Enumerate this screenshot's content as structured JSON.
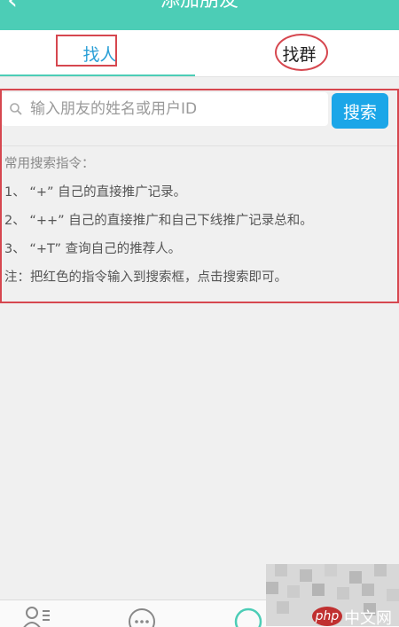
{
  "header": {
    "title": "添加朋友",
    "back_glyph": "‹"
  },
  "tabs": [
    {
      "label": "找人",
      "active": true
    },
    {
      "label": "找群",
      "active": false
    }
  ],
  "search": {
    "placeholder": "输入朋友的姓名或用户ID",
    "value": "",
    "button_label": "搜索"
  },
  "instructions": {
    "heading": "常用搜索指令：",
    "items": [
      "1、 “+” 自己的直接推广记录。",
      "2、 “++” 自己的直接推广和自己下线推广记录总和。",
      "3、 “+T” 查询自己的推荐人。"
    ],
    "note": "注：把红色的指令输入到搜索框，点击搜索即可。"
  },
  "bottom_nav": [
    {
      "icon": "contacts-icon"
    },
    {
      "icon": "chat-bubble-icon"
    },
    {
      "icon": "compass-icon",
      "active": true
    }
  ],
  "watermark": {
    "badge": "php",
    "text": "中文网"
  },
  "colors": {
    "header": "#4ccdb6",
    "active_tab": "#2a9fd6",
    "search_button": "#1ba6e8",
    "annotation": "#d6474f"
  }
}
